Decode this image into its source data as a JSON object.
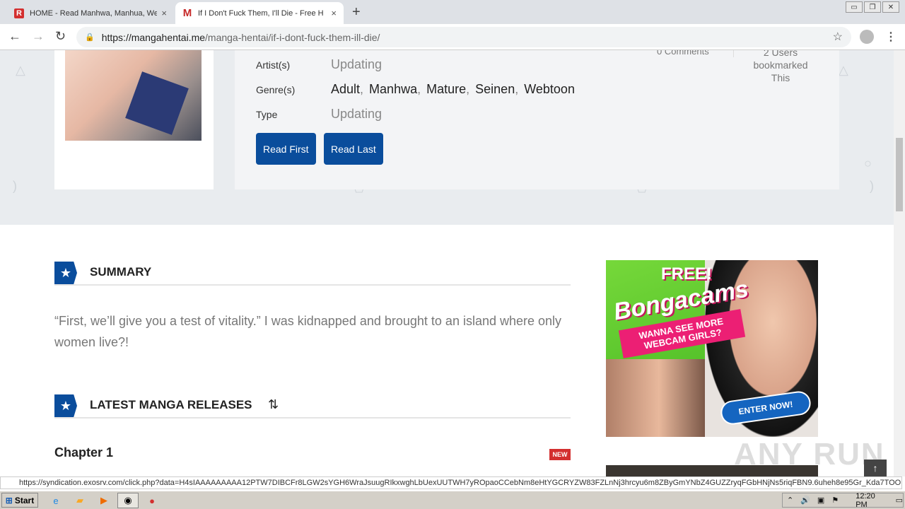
{
  "browser": {
    "tabs": [
      {
        "favicon": "R",
        "title": "HOME - Read Manhwa, Manhua, We",
        "close": "×"
      },
      {
        "favicon": "M",
        "title": "If I Don't Fuck Them, I'll Die - Free H",
        "close": "×"
      }
    ],
    "new_tab": "+",
    "url_domain": "https://mangahentai.me",
    "url_path": "/manga-hentai/if-i-dont-fuck-them-ill-die/"
  },
  "manga": {
    "stats_comments": "0 Comments",
    "stats_bookmarks": "2 Users bookmarked This",
    "artist_label": "Artist(s)",
    "artist_value": "Updating",
    "genre_label": "Genre(s)",
    "genres": [
      "Adult",
      "Manhwa",
      "Mature",
      "Seinen",
      "Webtoon"
    ],
    "type_label": "Type",
    "type_value": "Updating",
    "read_first": "Read First",
    "read_last": "Read Last"
  },
  "summary": {
    "heading": "SUMMARY",
    "text": "“First, we’ll give you a test of vitality.” I was kidnapped and brought to an island where only women live?!"
  },
  "releases": {
    "heading": "LATEST MANGA RELEASES",
    "chapter": "Chapter 1",
    "badge": "NEW"
  },
  "ad": {
    "free": "FREE!",
    "logo": "Bongacams",
    "banner": "WANNA SEE MORE WEBCAM GIRLS?",
    "enter": "ENTER NOW!"
  },
  "watermark": "ANY RUN",
  "status_link": "https://syndication.exosrv.com/click.php?data=H4sIAAAAAAAAA12PTW7DIBCFr8LGW2sYGH6WraJsuugRIkxwghLbUexUUTWH7yROpaoCCebNm8eHtYGCRYZW83FZLnNj3hrcyu6m8ZByGmYNbZ4GUZZryqFGbHNjNs5riqFBN9.6uheh8e95Gr_Kda7TOO.e3joeGr_5...",
  "taskbar": {
    "start": "Start",
    "clock": "12:20 PM"
  },
  "icons": {
    "back": "back-arrow-icon",
    "forward": "forward-arrow-icon",
    "reload": "reload-icon",
    "lock": "lock-icon",
    "star": "star-icon"
  }
}
